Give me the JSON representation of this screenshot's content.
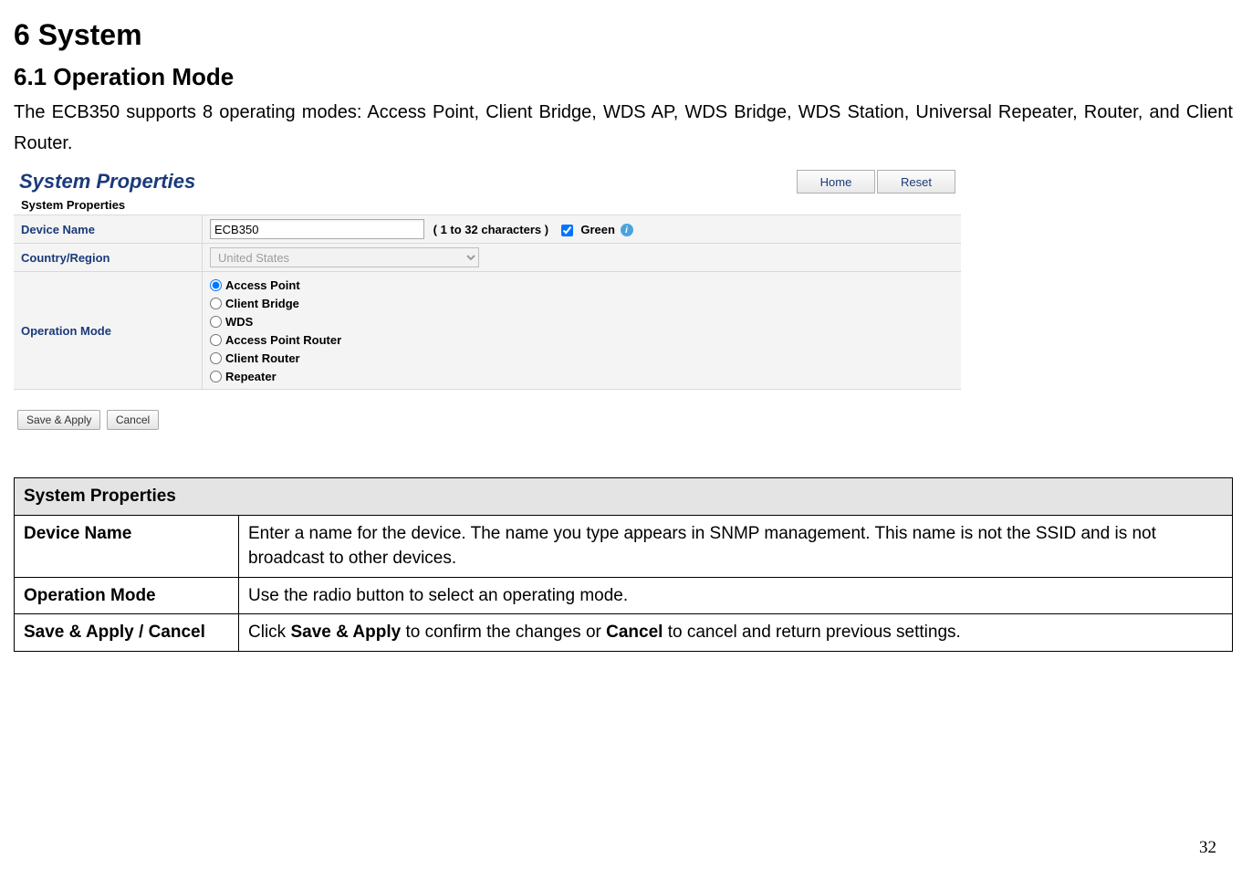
{
  "heading1": "6  System",
  "heading2": "6.1   Operation Mode",
  "intro": "The ECB350 supports 8 operating modes: Access Point, Client Bridge, WDS AP, WDS Bridge, WDS Station, Universal Repeater, Router, and Client Router.",
  "screenshot": {
    "title": "System Properties",
    "home_btn": "Home",
    "reset_btn": "Reset",
    "section_header": "System Properties",
    "rows": {
      "device_name_label": "Device Name",
      "device_name_value": "ECB350",
      "device_name_hint": "( 1 to 32 characters )",
      "green_label": "Green",
      "country_label": "Country/Region",
      "country_value": "United States",
      "opmode_label": "Operation Mode",
      "opmodes": {
        "ap": "Access Point",
        "cb": "Client Bridge",
        "wds": "WDS",
        "apr": "Access Point Router",
        "cr": "Client Router",
        "rep": "Repeater"
      }
    },
    "save_btn": "Save & Apply",
    "cancel_btn": "Cancel"
  },
  "desc": {
    "header": "System Properties",
    "r1_key": "Device Name",
    "r1_val": "Enter a name for the device. The name you type appears in SNMP management. This name is not the SSID and is not broadcast to other devices.",
    "r2_key": "Operation Mode",
    "r2_val": "Use the radio button to select an operating mode.",
    "r3_key": "Save & Apply / Cancel",
    "r3_val_pre": "Click ",
    "r3_val_b1": "Save & Apply",
    "r3_val_mid": " to confirm the changes or ",
    "r3_val_b2": "Cancel",
    "r3_val_post": " to cancel and return previous settings."
  },
  "page_num": "32"
}
